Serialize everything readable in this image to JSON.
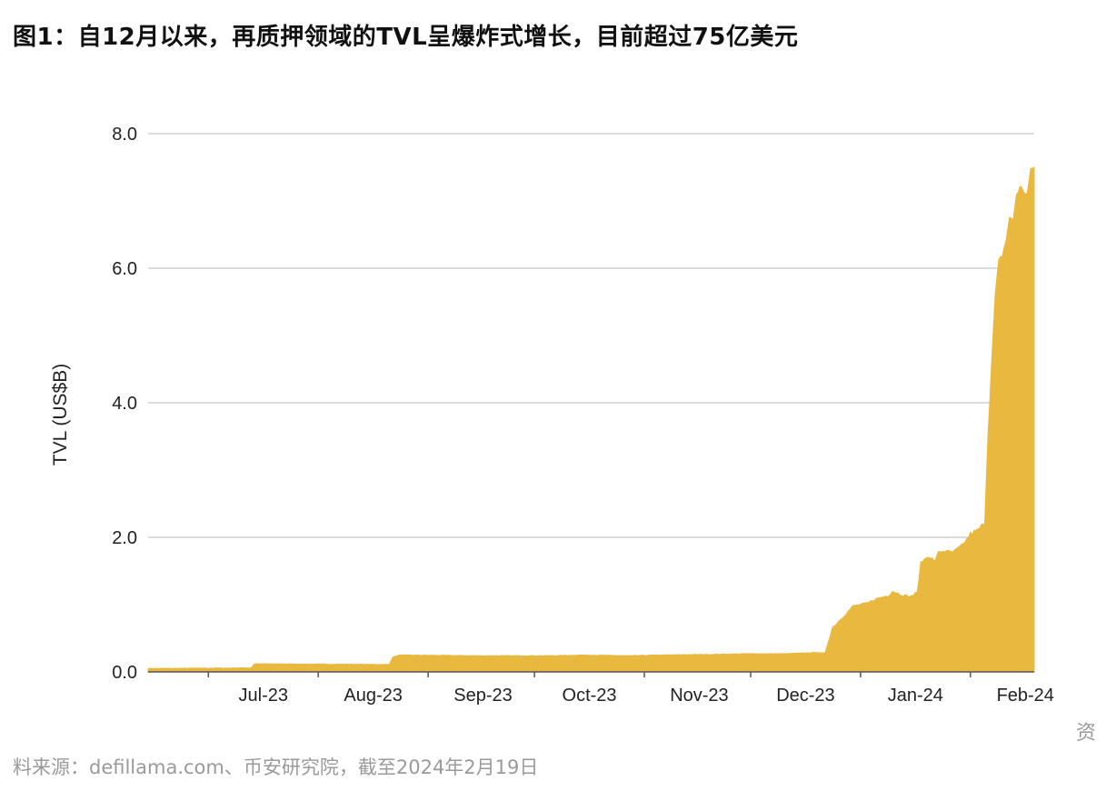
{
  "figure": {
    "title": "图1：自12月以来，再质押领域的TVL呈爆炸式增长，目前超过75亿美元",
    "source": "料来源：defillama.com、币安研究院，截至2024年2月19日",
    "side_char": "资"
  },
  "chart_data": {
    "type": "area",
    "title": "",
    "xlabel": "",
    "ylabel": "TVL (US$B)",
    "ylim": [
      0,
      8
    ],
    "yticks": [
      0,
      2,
      4,
      6,
      8
    ],
    "ytick_labels": [
      "0.0",
      "2.0",
      "4.0",
      "6.0",
      "8.0"
    ],
    "xlim": [
      "2023-06-14",
      "2024-02-19"
    ],
    "xticks": [
      {
        "date": "2023-07-01",
        "label": "Jul-23"
      },
      {
        "date": "2023-08-01",
        "label": "Aug-23"
      },
      {
        "date": "2023-09-01",
        "label": "Sep-23"
      },
      {
        "date": "2023-10-01",
        "label": "Oct-23"
      },
      {
        "date": "2023-11-01",
        "label": "Nov-23"
      },
      {
        "date": "2023-12-01",
        "label": "Dec-23"
      },
      {
        "date": "2024-01-01",
        "label": "Jan-24"
      },
      {
        "date": "2024-02-01",
        "label": "Feb-24"
      }
    ],
    "grid": true,
    "color": "#E8B93E",
    "series": [
      {
        "x": [
          "2023-06-14",
          "2023-07-13",
          "2023-07-14",
          "2023-08-21",
          "2023-08-22",
          "2023-08-24",
          "2023-09-15",
          "2023-10-05",
          "2023-10-15",
          "2023-10-28",
          "2023-11-05",
          "2023-11-20",
          "2023-11-30",
          "2023-12-10",
          "2023-12-16",
          "2023-12-20",
          "2023-12-21",
          "2023-12-22",
          "2023-12-24",
          "2023-12-27",
          "2023-12-30",
          "2024-01-03",
          "2024-01-05",
          "2024-01-09",
          "2024-01-10",
          "2024-01-13",
          "2024-01-15",
          "2024-01-17",
          "2024-01-18",
          "2024-01-20",
          "2024-01-22",
          "2024-01-23",
          "2024-01-25",
          "2024-01-27",
          "2024-01-30",
          "2024-02-01",
          "2024-02-03",
          "2024-02-04",
          "2024-02-05",
          "2024-02-06",
          "2024-02-07",
          "2024-02-08",
          "2024-02-09",
          "2024-02-10",
          "2024-02-11",
          "2024-02-12",
          "2024-02-13",
          "2024-02-14",
          "2024-02-15",
          "2024-02-16",
          "2024-02-17",
          "2024-02-18",
          "2024-02-19"
        ],
        "y": [
          0.05,
          0.06,
          0.12,
          0.11,
          0.22,
          0.25,
          0.24,
          0.24,
          0.25,
          0.24,
          0.25,
          0.26,
          0.27,
          0.27,
          0.28,
          0.29,
          0.28,
          0.28,
          0.65,
          0.82,
          0.98,
          1.02,
          1.08,
          1.14,
          1.2,
          1.14,
          1.12,
          1.18,
          1.62,
          1.72,
          1.65,
          1.78,
          1.8,
          1.78,
          1.9,
          2.05,
          2.1,
          2.16,
          2.2,
          3.6,
          4.6,
          5.6,
          6.1,
          6.2,
          6.4,
          6.75,
          6.7,
          7.1,
          7.2,
          7.15,
          7.1,
          7.45,
          7.5
        ]
      }
    ]
  }
}
